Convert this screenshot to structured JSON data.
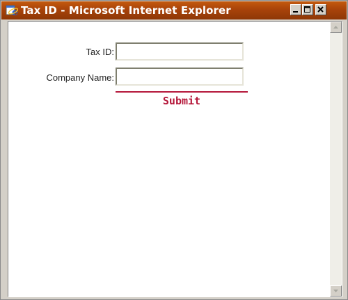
{
  "window": {
    "title": "Tax ID - Microsoft Internet Explorer",
    "app_icon": "internet-explorer-icon",
    "controls": [
      "minimize-icon",
      "maximize-icon",
      "close-icon"
    ]
  },
  "form": {
    "tax_id_label": "Tax ID:",
    "tax_id_value": "",
    "company_name_label": "Company Name:",
    "company_name_value": "",
    "submit_label": "Submit"
  },
  "colors": {
    "titlebar": "#a8430a",
    "submit_accent": "#b5173a",
    "window_face": "#d4d0c8"
  }
}
